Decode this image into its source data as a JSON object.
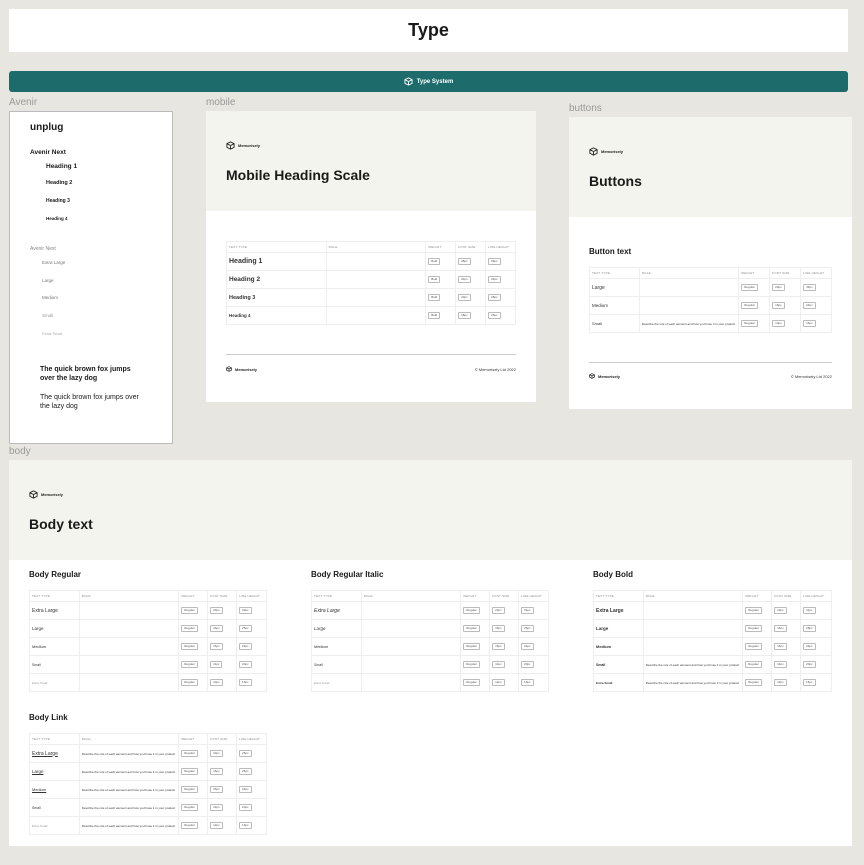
{
  "page": {
    "title": "Type",
    "banner": "Type System"
  },
  "labels": {
    "avenir": "Avenir",
    "mobile": "mobile",
    "buttons": "buttons",
    "body": "body"
  },
  "brand": "Memorisely",
  "copyright": "© Memorisely Ltd 2022",
  "headers": {
    "text_type": "TEXT TYPE",
    "role": "ROLE",
    "weight": "WEIGHT",
    "font_size": "FONT SIZE",
    "line_height": "LINE HEIGHT"
  },
  "description": "Describe the role of each element and how you'll use it in your product",
  "avenir": {
    "logo": "unplug",
    "family_bold": "Avenir Next",
    "headings": [
      "Heading 1",
      "Heading 2",
      "Heading 3",
      "Heading 4"
    ],
    "family": "Avenir Next",
    "sizes": [
      "Extra Large",
      "Large",
      "Medium",
      "Small",
      "Extra Small"
    ],
    "sample_bold": "The quick brown fox jumps over the lazy dog",
    "sample_regular": "The quick brown fox jumps over the lazy dog"
  },
  "mobile": {
    "title": "Mobile Heading Scale",
    "rows": [
      {
        "type": "Heading 1",
        "weight": "Bold",
        "size": "28px",
        "lh": "36px"
      },
      {
        "type": "Heading 2",
        "weight": "Bold",
        "size": "24px",
        "lh": "32px"
      },
      {
        "type": "Heading 3",
        "weight": "Bold",
        "size": "20px",
        "lh": "28px"
      },
      {
        "type": "Heading 4",
        "weight": "Bold",
        "size": "18px",
        "lh": "26px"
      }
    ]
  },
  "buttons": {
    "title": "Buttons",
    "section": "Button text",
    "rows": [
      {
        "type": "Large",
        "weight": "Regular",
        "size": "20px",
        "lh": "32px",
        "desc": ""
      },
      {
        "type": "Medium",
        "weight": "Regular",
        "size": "16px",
        "lh": "24px",
        "desc": ""
      },
      {
        "type": "Small",
        "weight": "Regular",
        "size": "14px",
        "lh": "16px",
        "desc": "Describe the role of each element and how you'll use it in your product"
      }
    ]
  },
  "body": {
    "title": "Body text",
    "regular": {
      "title": "Body Regular",
      "rows": [
        {
          "type": "Extra Large",
          "weight": "Regular",
          "size": "23px",
          "lh": "32px"
        },
        {
          "type": "Large",
          "weight": "Regular",
          "size": "16px",
          "lh": "26px"
        },
        {
          "type": "Medium",
          "weight": "Regular",
          "size": "15px",
          "lh": "24px"
        },
        {
          "type": "Small",
          "weight": "Regular",
          "size": "11px",
          "lh": "20px"
        },
        {
          "type": "Extra Small",
          "weight": "Regular",
          "size": "10px",
          "lh": "16px"
        }
      ]
    },
    "italic": {
      "title": "Body Regular Italic",
      "rows": [
        {
          "type": "Extra Large",
          "weight": "Regular",
          "size": "23px",
          "lh": "31px"
        },
        {
          "type": "Large",
          "weight": "Regular",
          "size": "16px",
          "lh": "26px"
        },
        {
          "type": "Medium",
          "weight": "Regular",
          "size": "15px",
          "lh": "24px"
        },
        {
          "type": "Small",
          "weight": "Regular",
          "size": "14px",
          "lh": "20px"
        },
        {
          "type": "Extra Small",
          "weight": "Regular",
          "size": "12px",
          "lh": "16px"
        }
      ]
    },
    "bold": {
      "title": "Body Bold",
      "rows": [
        {
          "type": "Extra Large",
          "weight": "Regular",
          "size": "23px",
          "lh": "41px",
          "desc": ""
        },
        {
          "type": "Large",
          "weight": "Regular",
          "size": "16px",
          "lh": "28px",
          "desc": ""
        },
        {
          "type": "Medium",
          "weight": "Regular",
          "size": "16px",
          "lh": "24px",
          "desc": ""
        },
        {
          "type": "Small",
          "weight": "Regular",
          "size": "14px",
          "lh": "20px",
          "desc": "Describe the role of each element and how you'll use it in your product"
        },
        {
          "type": "Extra Small",
          "weight": "Regular",
          "size": "12px",
          "lh": "16px",
          "desc": "Describe the role of each element and how you'll use it in your product"
        }
      ]
    },
    "link": {
      "title": "Body Link",
      "rows": [
        {
          "type": "Extra Large",
          "weight": "Regular",
          "size": "23px",
          "lh": "25px"
        },
        {
          "type": "Large",
          "weight": "Regular",
          "size": "16px",
          "lh": "26px"
        },
        {
          "type": "Medium",
          "weight": "Regular",
          "size": "15px",
          "lh": "24px"
        },
        {
          "type": "Small",
          "weight": "Regular",
          "size": "14px",
          "lh": "20px"
        },
        {
          "type": "Extra Small",
          "weight": "Regular",
          "size": "12px",
          "lh": "16px"
        }
      ]
    }
  }
}
